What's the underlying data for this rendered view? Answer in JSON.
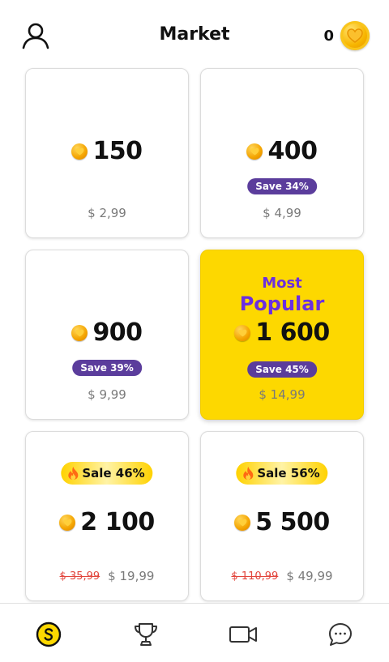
{
  "header": {
    "title": "Market",
    "balance": "0",
    "profile_icon": "user-icon",
    "balance_icon": "coin-heart-icon"
  },
  "packs": [
    {
      "amount": "150",
      "save": "",
      "price": "$ 2,99",
      "old_price": ""
    },
    {
      "amount": "400",
      "save": "Save 34%",
      "price": "$ 4,99",
      "old_price": ""
    },
    {
      "amount": "900",
      "save": "Save 39%",
      "price": "$ 9,99",
      "old_price": ""
    },
    {
      "amount": "1 600",
      "save": "Save 45%",
      "price": "$ 14,99",
      "old_price": "",
      "featured_line1": "Most",
      "featured_line2": "Popular"
    },
    {
      "amount": "2 100",
      "sale": "Sale 46%",
      "price": "$ 19,99",
      "old_price": "$ 35,99"
    },
    {
      "amount": "5 500",
      "sale": "Sale 56%",
      "price": "$ 49,99",
      "old_price": "$ 110,99"
    }
  ],
  "tabs": [
    {
      "icon": "market-coin-icon",
      "active": true
    },
    {
      "icon": "trophy-icon",
      "active": false
    },
    {
      "icon": "video-camera-icon",
      "active": false
    },
    {
      "icon": "chat-bubble-icon",
      "active": false
    }
  ],
  "colors": {
    "featured_bg": "#fdd800",
    "save_badge": "#5b3d9c",
    "popular_text": "#6b2fe0",
    "old_price": "#e2453c",
    "coin": "#f4a400"
  }
}
